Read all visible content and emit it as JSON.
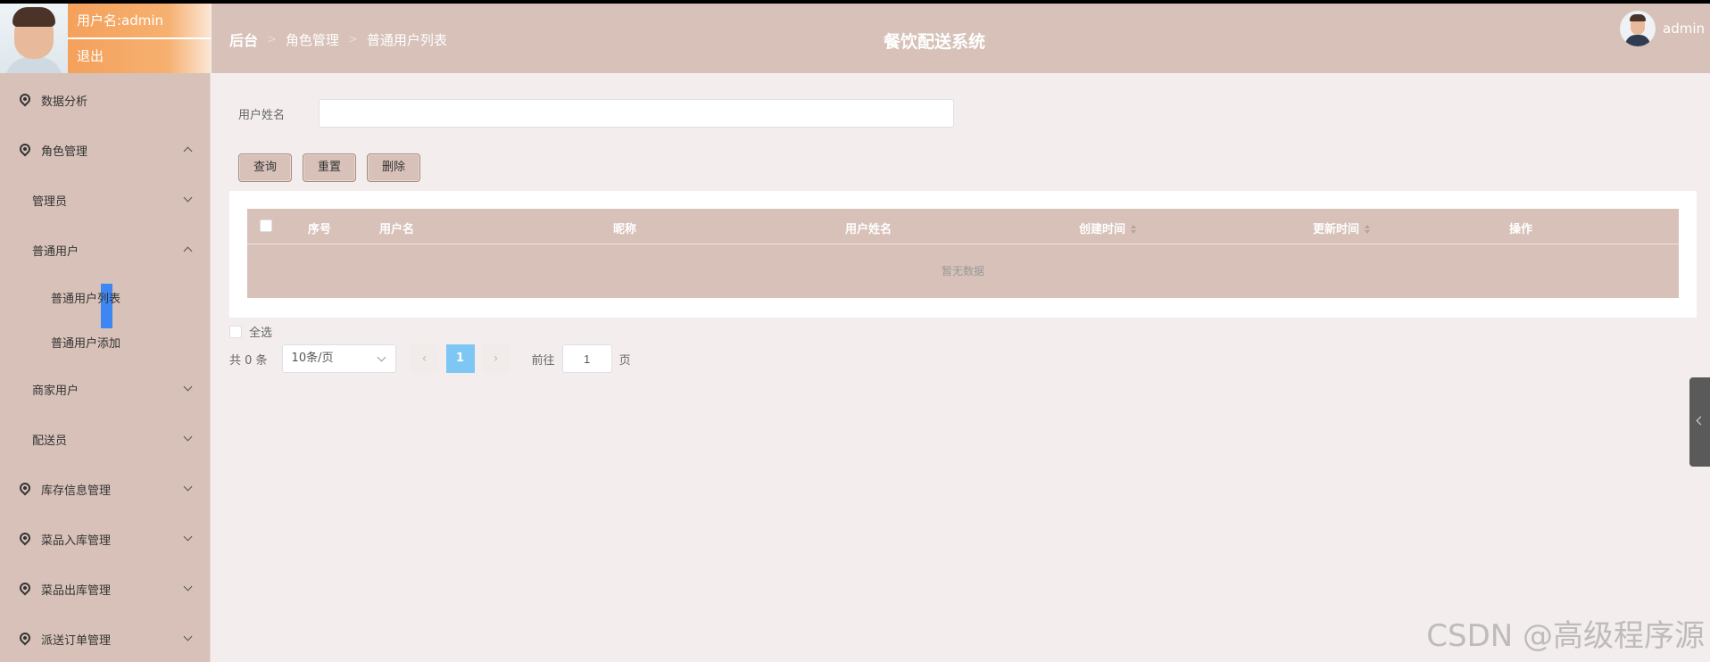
{
  "user": {
    "name_label": "用户名:admin",
    "logout": "退出"
  },
  "header": {
    "breadcrumb": [
      "后台",
      "角色管理",
      "普通用户列表"
    ],
    "sep": ">",
    "title": "餐饮配送系统",
    "username": "admin"
  },
  "sidebar": {
    "items": [
      {
        "label": "数据分析"
      },
      {
        "label": "角色管理"
      },
      {
        "label": "管理员"
      },
      {
        "label": "普通用户"
      },
      {
        "label": "普通用户列表"
      },
      {
        "label": "普通用户添加"
      },
      {
        "label": "商家用户"
      },
      {
        "label": "配送员"
      },
      {
        "label": "库存信息管理"
      },
      {
        "label": "菜品入库管理"
      },
      {
        "label": "菜品出库管理"
      },
      {
        "label": "派送订单管理"
      }
    ]
  },
  "search": {
    "label": "用户姓名",
    "value": "",
    "placeholder": ""
  },
  "buttons": {
    "query": "查询",
    "reset": "重置",
    "delete": "删除"
  },
  "table": {
    "columns": [
      "序号",
      "用户名",
      "昵称",
      "用户姓名",
      "创建时间",
      "更新时间",
      "操作"
    ],
    "empty_text": "暂无数据"
  },
  "select_all": "全选",
  "pager": {
    "total": "共 0 条",
    "page_size": "10条/页",
    "prev": "‹",
    "next": "›",
    "current": "1",
    "goto": "前往",
    "jump_value": "1",
    "unit": "页"
  },
  "watermark": "CSDN @高级程序源"
}
